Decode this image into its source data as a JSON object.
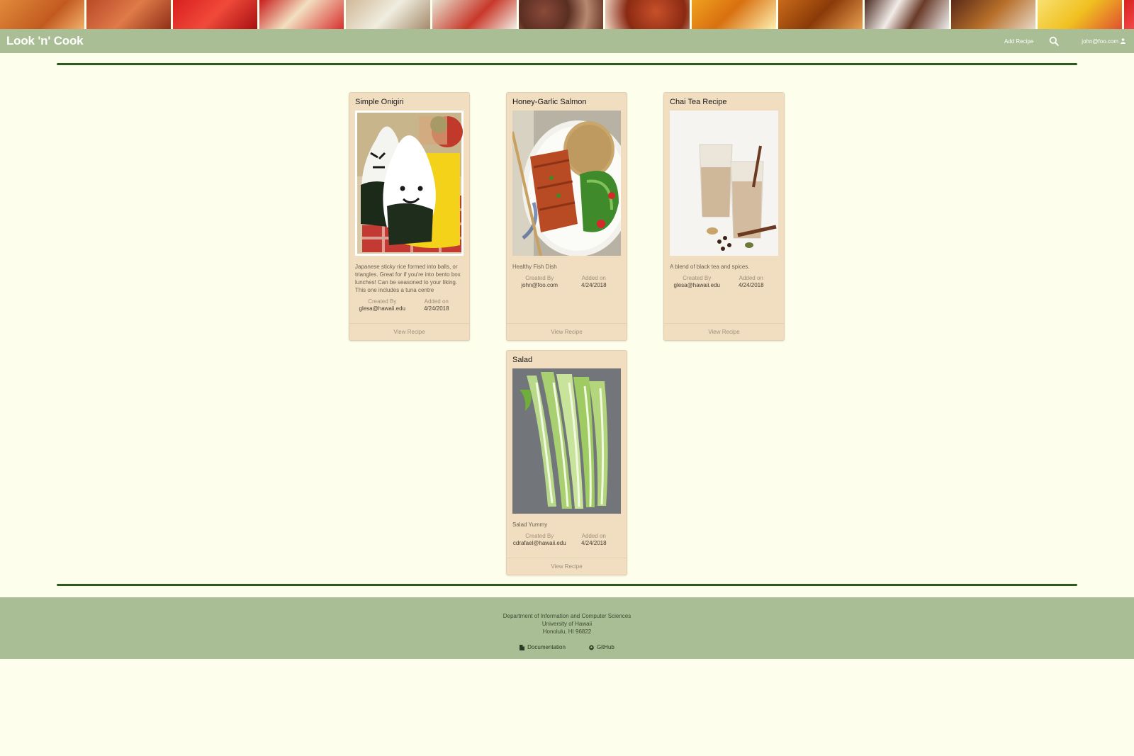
{
  "navbar": {
    "brand": "Look 'n' Cook",
    "add_recipe": "Add Recipe",
    "search_icon": "search-icon",
    "user_label": "john@foo.com",
    "user_icon": "user-icon",
    "bg_color": "#a9be95"
  },
  "page_heading": "",
  "recipes": [
    {
      "title": "Simple Onigiri",
      "description": "Japanese sticky rice formed into balls, or triangles. Great for if you're into bento box lunches! Can be seasoned to your liking. This one includes a tuna centre",
      "created_by_label": "Created By",
      "created_by": "glesa@hawaii.edu",
      "added_on_label": "Added on",
      "added_on": "4/24/2018",
      "view_label": "View Recipe"
    },
    {
      "title": "Honey-Garlic Salmon",
      "description": "Healthy Fish Dish",
      "created_by_label": "Created By",
      "created_by": "john@foo.com",
      "added_on_label": "Added on",
      "added_on": "4/24/2018",
      "view_label": "View Recipe"
    },
    {
      "title": "Chai Tea Recipe",
      "description": "A blend of black tea and spices.",
      "created_by_label": "Created By",
      "created_by": "glesa@hawaii.edu",
      "added_on_label": "Added on",
      "added_on": "4/24/2018",
      "view_label": "View Recipe"
    },
    {
      "title": "Salad",
      "description": "Salad Yummy",
      "created_by_label": "Created By",
      "created_by": "cdrafael@hawaii.edu",
      "added_on_label": "Added on",
      "added_on": "4/24/2018",
      "view_label": "View Recipe"
    }
  ],
  "footer": {
    "line1": "Department of Information and Computer Sciences",
    "line2": "University of Hawaii",
    "line3": "Honolulu, HI 96822",
    "documentation": "Documentation",
    "documentation_icon": "file-icon",
    "github": "GitHub",
    "github_icon": "github-icon"
  },
  "colors": {
    "page_bg": "#fefeec",
    "card_bg": "#f1dec1",
    "divider": "#2f5a1e"
  }
}
